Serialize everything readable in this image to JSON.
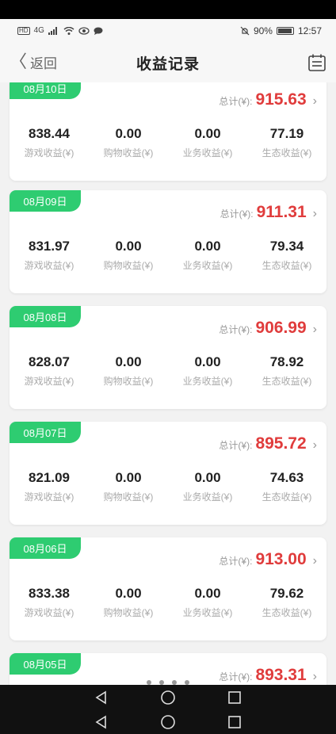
{
  "status_bar": {
    "hd": "HD",
    "network": "4G",
    "battery": "90%",
    "time": "12:57"
  },
  "header": {
    "back_label": "返回",
    "title": "收益记录"
  },
  "labels": {
    "total": "总计(¥):",
    "game": "游戏收益(¥)",
    "shop": "购物收益(¥)",
    "business": "业务收益(¥)",
    "eco": "生态收益(¥)"
  },
  "records": [
    {
      "date": "08月10日",
      "total": "915.63",
      "game": "838.44",
      "shop": "0.00",
      "business": "0.00",
      "eco": "77.19"
    },
    {
      "date": "08月09日",
      "total": "911.31",
      "game": "831.97",
      "shop": "0.00",
      "business": "0.00",
      "eco": "79.34"
    },
    {
      "date": "08月08日",
      "total": "906.99",
      "game": "828.07",
      "shop": "0.00",
      "business": "0.00",
      "eco": "78.92"
    },
    {
      "date": "08月07日",
      "total": "895.72",
      "game": "821.09",
      "shop": "0.00",
      "business": "0.00",
      "eco": "74.63"
    },
    {
      "date": "08月06日",
      "total": "913.00",
      "game": "833.38",
      "shop": "0.00",
      "business": "0.00",
      "eco": "79.62"
    },
    {
      "date": "08月05日",
      "total": "893.31",
      "game": "",
      "shop": "",
      "business": "",
      "eco": ""
    }
  ],
  "colors": {
    "accent_green": "#2ecc71",
    "total_red": "#e03c3c"
  }
}
